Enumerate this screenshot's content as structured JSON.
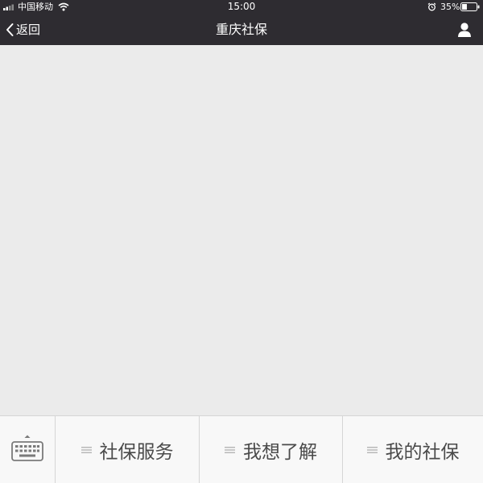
{
  "status_bar": {
    "carrier": "中国移动",
    "time": "15:00",
    "battery_percent": "35%",
    "battery_level": 0.35
  },
  "nav": {
    "back_label": "返回",
    "title": "重庆社保",
    "right_icon": "person-icon"
  },
  "menu": {
    "left_icon": "keyboard-icon",
    "items": [
      {
        "label": "社保服务",
        "icon": "menu-lines-icon"
      },
      {
        "label": "我想了解",
        "icon": "menu-lines-icon"
      },
      {
        "label": "我的社保",
        "icon": "menu-lines-icon"
      }
    ]
  },
  "colors": {
    "header_bg": "#2e2c31",
    "content_bg": "#ebebeb",
    "menu_bg": "#f8f8f8",
    "menu_text": "#4a4a4a",
    "divider": "#d5d5d5"
  }
}
